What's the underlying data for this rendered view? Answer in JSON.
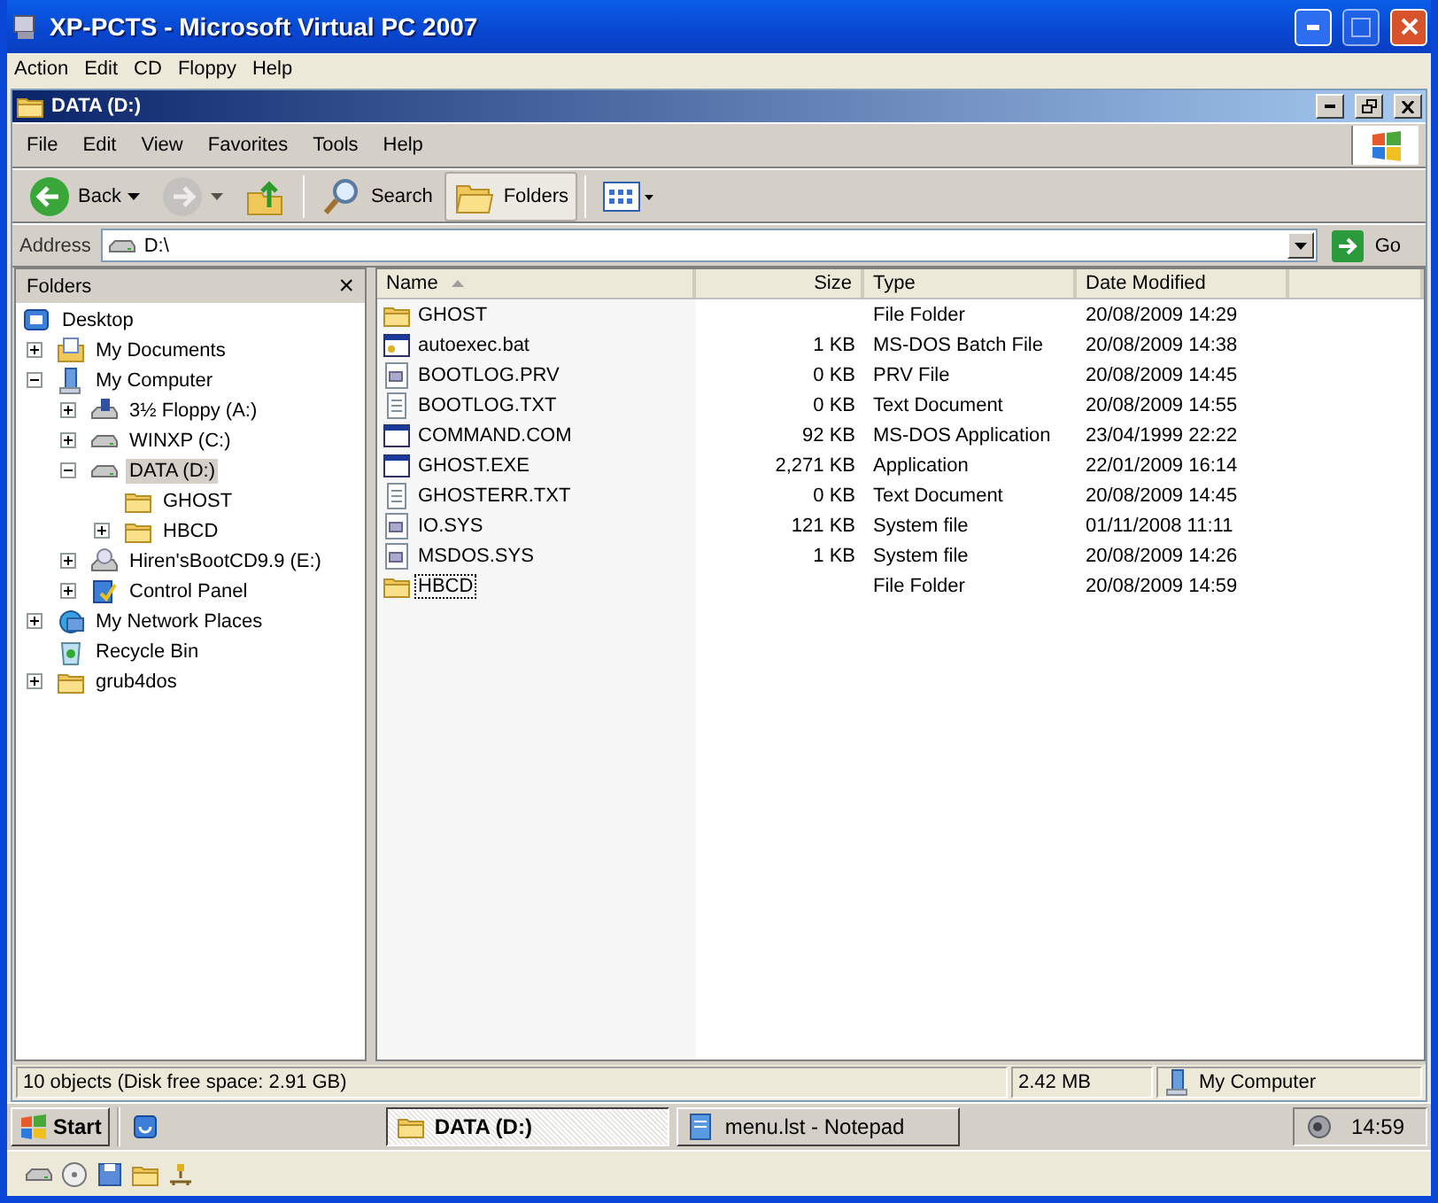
{
  "window": {
    "title": "XP-PCTS - Microsoft Virtual PC 2007"
  },
  "vpc_menu": [
    "Action",
    "Edit",
    "CD",
    "Floppy",
    "Help"
  ],
  "explorer": {
    "title": "DATA (D:)",
    "menu": [
      "File",
      "Edit",
      "View",
      "Favorites",
      "Tools",
      "Help"
    ],
    "toolbar": [
      {
        "kind": "back",
        "label": "Back",
        "disabled": false,
        "pressed": false
      },
      {
        "kind": "forward",
        "disabled": true,
        "pressed": false
      },
      {
        "kind": "up",
        "disabled": false,
        "pressed": false
      },
      {
        "kind": "search",
        "label": "Search",
        "disabled": false,
        "pressed": false
      },
      {
        "kind": "folders",
        "label": "Folders",
        "disabled": false,
        "pressed": true
      },
      {
        "kind": "views",
        "disabled": false,
        "pressed": false
      }
    ],
    "address": {
      "label": "Address",
      "value": "D:\\",
      "go": "Go"
    },
    "folders_pane": {
      "title": "Folders",
      "close": "×",
      "tree": [
        {
          "label": "Desktop",
          "kind": "desktop",
          "selected": false,
          "children": [
            {
              "label": "My Documents",
              "kind": "documents",
              "expanded": false,
              "selected": false
            },
            {
              "label": "My Computer",
              "kind": "computer",
              "expanded": true,
              "selected": false,
              "children": [
                {
                  "label": "3½ Floppy (A:)",
                  "kind": "floppy",
                  "expanded": false,
                  "selected": false
                },
                {
                  "label": "WINXP (C:)",
                  "kind": "drive",
                  "expanded": false,
                  "selected": false
                },
                {
                  "label": "DATA (D:)",
                  "kind": "drive",
                  "expanded": true,
                  "selected": true,
                  "children": [
                    {
                      "label": "GHOST",
                      "kind": "folder",
                      "selected": false
                    },
                    {
                      "label": "HBCD",
                      "kind": "folder",
                      "expanded": false,
                      "selected": false
                    }
                  ]
                },
                {
                  "label": "Hiren'sBootCD9.9 (E:)",
                  "kind": "cdrom",
                  "expanded": false,
                  "selected": false
                },
                {
                  "label": "Control Panel",
                  "kind": "control",
                  "expanded": false,
                  "selected": false
                }
              ]
            },
            {
              "label": "My Network Places",
              "kind": "network",
              "expanded": false,
              "selected": false
            },
            {
              "label": "Recycle Bin",
              "kind": "recycle",
              "selected": false
            },
            {
              "label": "grub4dos",
              "kind": "folder",
              "expanded": false,
              "selected": false
            }
          ]
        }
      ]
    },
    "file_list": {
      "columns": [
        {
          "label": "Name",
          "sorted": true
        },
        {
          "label": "Size",
          "sorted": false
        },
        {
          "label": "Type",
          "sorted": false
        },
        {
          "label": "Date Modified",
          "sorted": false
        }
      ],
      "rows": [
        {
          "kind": "folder",
          "name": "GHOST",
          "type": "File Folder",
          "date": "20/08/2009 14:29",
          "focused": false
        },
        {
          "kind": "batch",
          "name": "autoexec.bat",
          "size": "1 KB",
          "type": "MS-DOS Batch File",
          "date": "20/08/2009 14:38",
          "focused": false
        },
        {
          "kind": "system",
          "name": "BOOTLOG.PRV",
          "size": "0 KB",
          "type": "PRV File",
          "date": "20/08/2009 14:45",
          "focused": false
        },
        {
          "kind": "text",
          "name": "BOOTLOG.TXT",
          "size": "0 KB",
          "type": "Text Document",
          "date": "20/08/2009 14:55",
          "focused": false
        },
        {
          "kind": "app",
          "name": "COMMAND.COM",
          "size": "92 KB",
          "type": "MS-DOS Application",
          "date": "23/04/1999 22:22",
          "focused": false
        },
        {
          "kind": "app",
          "name": "GHOST.EXE",
          "size": "2,271 KB",
          "type": "Application",
          "date": "22/01/2009 16:14",
          "focused": false
        },
        {
          "kind": "text",
          "name": "GHOSTERR.TXT",
          "size": "0 KB",
          "type": "Text Document",
          "date": "20/08/2009 14:45",
          "focused": false
        },
        {
          "kind": "system",
          "name": "IO.SYS",
          "size": "121 KB",
          "type": "System file",
          "date": "01/11/2008 11:11",
          "focused": false
        },
        {
          "kind": "system",
          "name": "MSDOS.SYS",
          "size": "1 KB",
          "type": "System file",
          "date": "20/08/2009 14:26",
          "focused": false
        },
        {
          "kind": "folder",
          "name": "HBCD",
          "type": "File Folder",
          "date": "20/08/2009 14:59",
          "focused": true
        }
      ]
    },
    "status_bar": {
      "summary": "10 objects (Disk free space: 2.91 GB)",
      "size": "2.42 MB",
      "zone": "My Computer"
    }
  },
  "taskbar": {
    "start": "Start",
    "tasks": [
      {
        "label": "DATA (D:)",
        "kind": "folder",
        "selected": true
      },
      {
        "label": "menu.lst - Notepad",
        "kind": "notepad",
        "selected": false
      }
    ],
    "clock": "14:59"
  }
}
